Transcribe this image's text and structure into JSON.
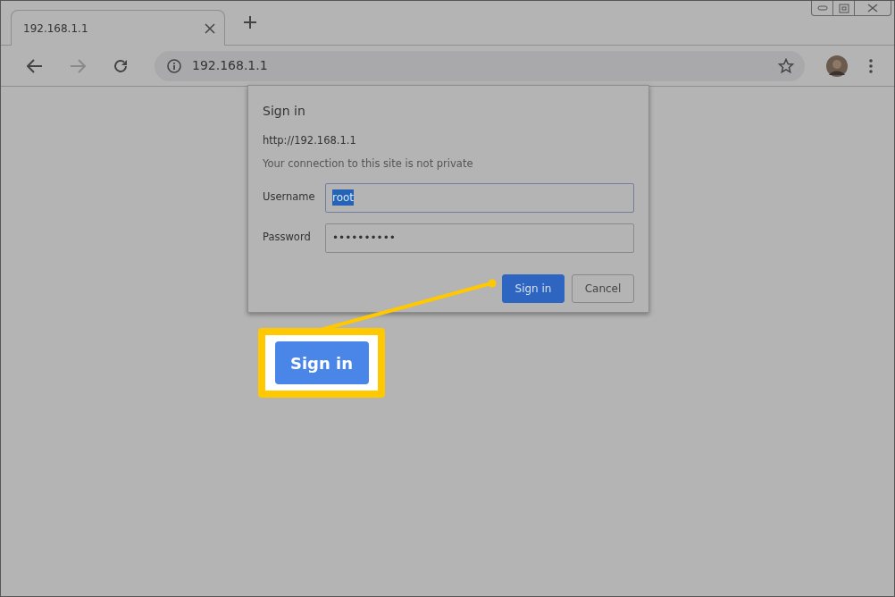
{
  "tabs": [
    {
      "label": "192.168.1.1",
      "selected": true
    }
  ],
  "address_bar": {
    "url": "192.168.1.1"
  },
  "dialog": {
    "title": "Sign in",
    "origin": "http://192.168.1.1",
    "note": "Your connection to this site is not private",
    "fields": [
      {
        "label": "Username",
        "value": "root",
        "selected": true
      },
      {
        "label": "Password",
        "value": "••••••••••",
        "selected": false
      }
    ],
    "buttons": [
      {
        "label": "Sign in",
        "kind": "primary"
      },
      {
        "label": "Cancel",
        "kind": "secondary"
      }
    ]
  },
  "callout": {
    "label": "Sign in"
  }
}
